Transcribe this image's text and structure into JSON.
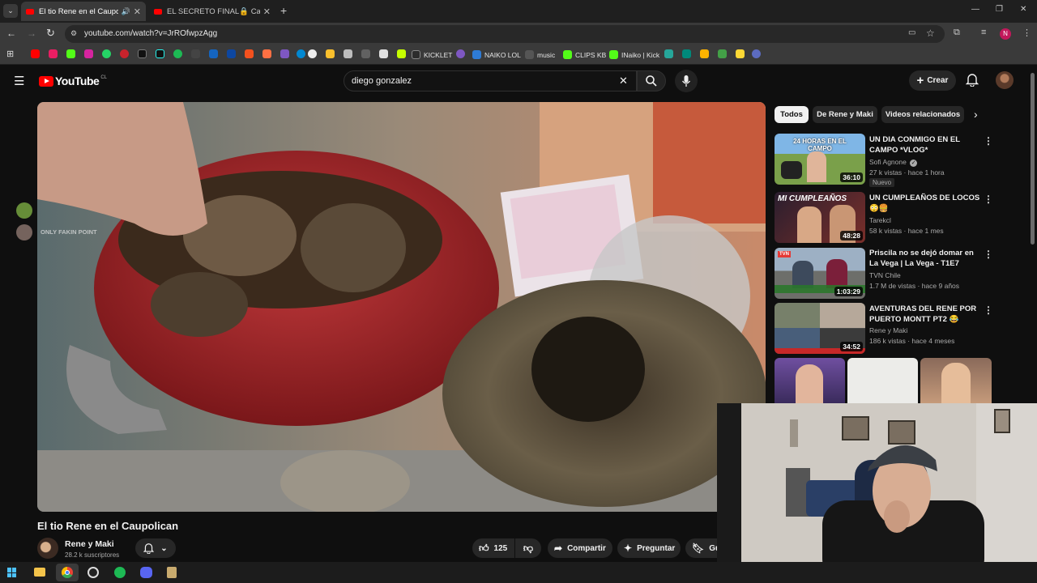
{
  "browser": {
    "tabs": [
      {
        "title": "El tio Rene en el Caupolican",
        "active": true
      },
      {
        "title": "EL SECRETO FINAL🔒 Capítulo",
        "active": false
      }
    ],
    "new_tab": "+",
    "url": "youtube.com/watch?v=JrROfwpzAgg",
    "window_controls": {
      "minimize": "—",
      "restore": "❐",
      "close": "✕"
    },
    "bookmarks": [
      {
        "label": "KICKLET",
        "color": "#2c2c2c"
      },
      {
        "label": "NAIKO LOL",
        "color": "#2e7bd6"
      },
      {
        "label": "music",
        "color": "#555555"
      },
      {
        "label": "CLIPS KB",
        "color": "#53fc18"
      },
      {
        "label": "INaiko | Kick",
        "color": "#53fc18"
      }
    ],
    "profile_letter": "N"
  },
  "youtube": {
    "logo_text": "YouTube",
    "region": "CL",
    "search_query": "diego gonzalez",
    "create_label": "Crear"
  },
  "video": {
    "title": "El tio Rene en el Caupolican",
    "overlay_text": "ONLY FAKIN POINT",
    "channel_name": "Rene y Maki",
    "subscribers": "28.2 k suscriptores",
    "likes": "125",
    "share_label": "Compartir",
    "ask_label": "Preguntar",
    "save_label": "Gu"
  },
  "sidebar": {
    "chips": [
      "Todos",
      "De Rene y Maki",
      "Videos relacionados"
    ],
    "items": [
      {
        "title": "UN DIA CONMIGO EN EL CAMPO *VLOG*",
        "channel": "Sofi Agnone",
        "verified": true,
        "meta": "27 k vistas · hace 1 hora",
        "badge": "Nuevo",
        "duration": "36:10",
        "thumb_text": "24 HORAS EN EL CAMPO"
      },
      {
        "title": "UN CUMPLEAÑOS DE LOCOS 😳🍔",
        "channel": "Tarekcl",
        "verified": false,
        "meta": "58 k vistas · hace 1 mes",
        "badge": "",
        "duration": "48:28",
        "thumb_text": "MI CUMPLEAÑOS"
      },
      {
        "title": "Priscila no se dejó domar en La Vega | La Vega - T1E7",
        "channel": "TVN Chile",
        "verified": false,
        "meta": "1.7 M de vistas · hace 9 años",
        "badge": "",
        "duration": "1:03:29",
        "thumb_text": "TVN"
      },
      {
        "title": "AVENTURAS DEL RENE POR PUERTO MONTT PT2 😂",
        "channel": "Rene y Maki",
        "verified": false,
        "meta": "186 k vistas · hace 4 meses",
        "badge": "",
        "duration": "34:52",
        "thumb_text": ""
      }
    ]
  },
  "colors": {
    "background": "#0f0f0f",
    "accent": "#ff0000",
    "chip_bg": "#272727"
  }
}
